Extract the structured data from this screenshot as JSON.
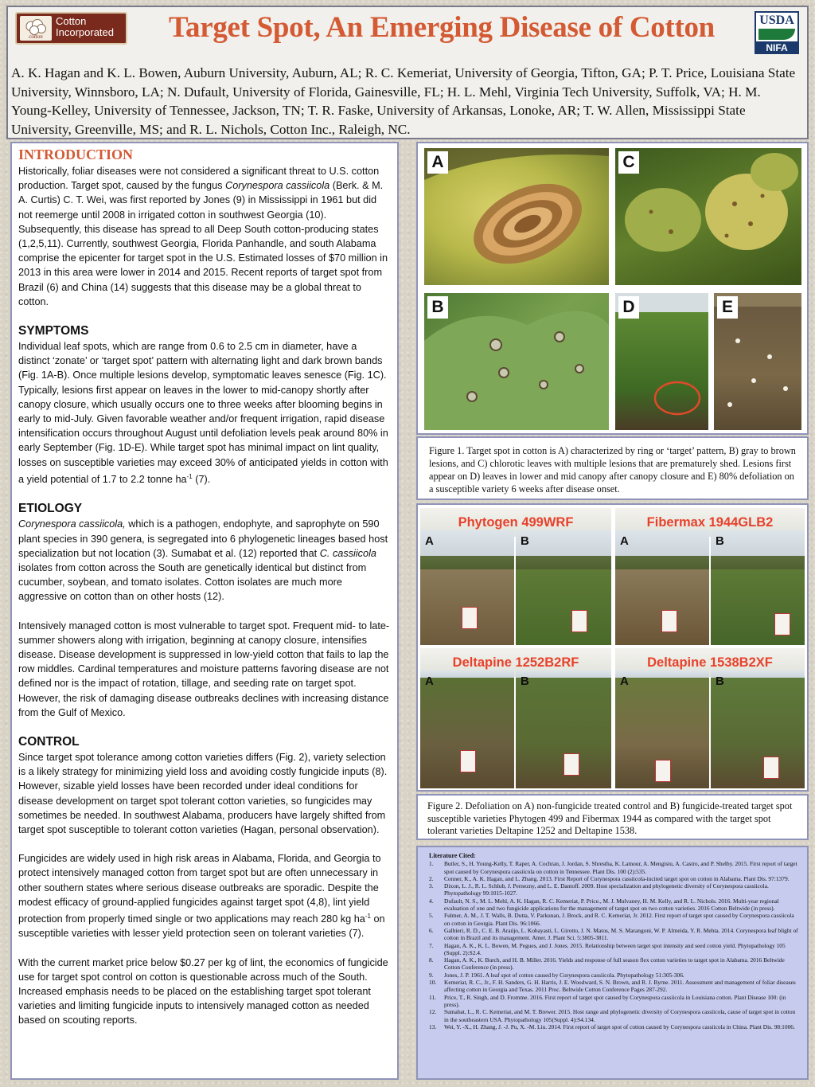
{
  "header": {
    "title": "Target Spot, An Emerging Disease of Cotton",
    "authors": "A. K. Hagan and K. L. Bowen, Auburn University, Auburn, AL; R. C. Kemeriat, University of Georgia, Tifton, GA; P. T. Price, Louisiana State University, Winnsboro, LA; N. Dufault, University of Florida, Gainesville, FL; H. L. Mehl, Virginia Tech University, Suffolk, VA; H. M. Young-Kelley, University of Tennessee, Jackson, TN; T. R. Faske, University of Arkansas, Lonoke, AR; T. W. Allen, Mississippi State University, Greenville, MS; and R. L. Nichols, Cotton Inc., Raleigh, NC.",
    "left_logo": {
      "line1": "Cotton",
      "line2": "Incorporated",
      "icon": "cotton-boll-icon"
    },
    "right_logo": {
      "top": "USDA",
      "bottom": "NIFA"
    }
  },
  "introduction": {
    "heading": "INTRODUCTION",
    "p1_a": "Historically, foliar diseases were not considered a significant threat to U.S. cotton production.  Target spot, caused by the fungus ",
    "p1_italic": "Corynespora cassiicola",
    "p1_b": " (Berk. & M. A. Curtis) C. T. Wei, was first reported by Jones (9) in Mississippi in 1961 but did not reemerge until 2008 in irrigated cotton in southwest Georgia (10). Subsequently, this disease has spread to all Deep South cotton-producing states (1,2,5,11). Currently, southwest Georgia, Florida Panhandle, and south Alabama comprise the epicenter for target spot in the U.S.  Estimated losses of $70 million in 2013 in this area were lower in 2014 and 2015. Recent reports of target spot from Brazil (6) and China (14) suggests that this disease may be a global threat to cotton."
  },
  "symptoms": {
    "heading": "SYMPTOMS",
    "p1_a": "Individual leaf spots, which are range from 0.6  to 2.5 cm in diameter, have a distinct ‘zonate’ or ‘target spot’ pattern with alternating light and dark brown bands (Fig. 1A-B).  Once multiple lesions develop, symptomatic leaves senesce (Fig. 1C).  Typically, lesions first appear on leaves in the lower to mid-canopy shortly after canopy closure, which usually occurs one to three weeks after blooming begins in early to mid-July.  Given favorable weather and/or frequent irrigation, rapid disease intensification occurs throughout August until defoliation levels peak around 80% in early September (Fig. 1D-E).  While target spot has minimal impact on lint quality, losses on susceptible varieties may exceed 30% of anticipated yields in cotton with a yield potential of 1.7 to 2.2 tonne ha",
    "p1_sup": "-1",
    "p1_b": " (7)."
  },
  "etiology": {
    "heading": "ETIOLOGY",
    "p1_italic": "Corynespora cassiicola,",
    "p1_a": " which is a pathogen, endophyte, and saprophyte on 590 plant species in 390 genera, is segregated into 6 phylogenetic lineages based host specialization but not location (3).  Sumabat et al. (12) reported that ",
    "p1_italic2": "C. cassiicola",
    "p1_b": " isolates from cotton across the South are genetically identical but distinct from cucumber, soybean, and tomato isolates.  Cotton isolates are much more aggressive on cotton than on other hosts (12).",
    "p2": "Intensively managed cotton is most vulnerable to target spot. Frequent mid- to late-summer showers along with irrigation, beginning at canopy closure, intensifies disease. Disease development is suppressed in low-yield cotton that fails to lap the row middles. Cardinal temperatures and moisture patterns favoring disease are not defined nor is the impact of rotation, tillage, and seeding rate on target spot. However, the risk of damaging disease outbreaks declines with increasing distance from the Gulf of Mexico."
  },
  "control": {
    "heading": "CONTROL",
    "p1": "Since target spot tolerance among cotton varieties differs (Fig. 2), variety selection is a likely strategy for minimizing yield loss and avoiding costly fungicide inputs (8). However, sizable yield losses have been recorded under ideal conditions for disease development on target spot tolerant cotton varieties, so fungicides may sometimes be needed.  In southwest Alabama, producers have largely shifted from target spot susceptible to tolerant cotton varieties (Hagan, personal observation).",
    "p2_a": "Fungicides are widely used in high risk areas in Alabama, Florida, and Georgia to protect intensively managed cotton from target spot but are often unnecessary in other southern states where serious disease outbreaks are sporadic. Despite the modest efficacy of ground-applied fungicides against target spot (4,8), lint yield protection from properly timed single or two applications may reach 280 kg ha",
    "p2_sup": "-1",
    "p2_b": " on susceptible varieties with lesser yield protection seen on tolerant varieties (7).",
    "p3": "With the current market price below $0.27 per kg of lint, the economics of fungicide use for target spot control on cotton is questionable across much of the South. Increased emphasis needs to be placed on the establishing target spot tolerant varieties and limiting fungicide inputs to intensively managed cotton as needed based on scouting reports."
  },
  "figure1": {
    "labels": [
      "A",
      "C",
      "B",
      "D",
      "E"
    ],
    "caption": "Figure 1. Target spot in cotton is A) characterized by ring or ‘target’ pattern, B) gray to brown lesions, and C) chlorotic leaves with multiple lesions that are prematurely shed.  Lesions first appear on D) leaves in lower and mid canopy after canopy closure and E) 80% defoliation on a susceptible variety 6 weeks after disease onset."
  },
  "figure2": {
    "panels": [
      {
        "title": "Phytogen 499WRF",
        "a": "A",
        "b": "B"
      },
      {
        "title": "Fibermax 1944GLB2",
        "a": "A",
        "b": "B"
      },
      {
        "title": "Deltapine 1252B2RF",
        "a": "A",
        "b": "B"
      },
      {
        "title": "Deltapine 1538B2XF",
        "a": "A",
        "b": "B"
      }
    ],
    "caption": "Figure 2. Defoliation on A) non-fungicide treated control and B) fungicide-treated target spot susceptible varieties Phytogen 499 and Fibermax 1944 as compared with the target spot tolerant varieties Deltapine 1252 and Deltapine 1538."
  },
  "literature": {
    "heading": "Literature Cited:",
    "refs": [
      {
        "n": "1.",
        "text": "Butler, S., H. Young-Kelly, T. Raper, A. Cochran, J. Jordan, S. Shrestha, K. Lamour, A. Mengistu, A. Castro, and P. Shelby. 2015. First report of target spot caused by Corynespora cassiicola on cotton in Tennessee.  Plant Dis. 100 (2):535."
      },
      {
        "n": "2.",
        "text": "Conner, K., A. K. Hagan, and L. Zhang. 2013. First Report of Corynespora cassiicola-incited target spot on cotton in Alabama. Plant Dis. 97:1379."
      },
      {
        "n": "3.",
        "text": "Dixon, L. J., R. L. Schlub, J. Pernezny, and L. E. Dantoff. 2009. Host specialization and phylogenetic diversity of Corynespora cassiicola.  Phytopathology 99:1015-1027."
      },
      {
        "n": "4.",
        "text": "Dufault, N. S., M. L. Mehl, A. K. Hagan, R. C. Kemeriat, P. Price., M. J. Mulvaney, H. M. Kelly, and R. L. Nichols. 2016. Multi-year regional evaluation of one and two fungicide applications for the management of target spot on two cotton varieties. 2016 Cotton Beltwide (in press)."
      },
      {
        "n": "5.",
        "text": "Fulmer, A. M., J. T. Walls, B. Dutta, V. Parkunan, J. Brock, and R. C. Kemeriat, Jr. 2012. First report of target spot caused by Corynespora cassiicola on cotton in Georgia. Plant Dis. 96:1066."
      },
      {
        "n": "6.",
        "text": "Galbieri, R. D., C. E. B. Araújo, L. Kobayasti, L. Girotto, J. N. Matos, M. S. Marangoni, W. P. Almeida, Y. R. Mehta. 2014. Corynespora leaf blight of cotton in Brazil and its management.  Amer. J. Plant Sci. 5:3805-3811."
      },
      {
        "n": "7.",
        "text": "Hagan, A. K., K. L. Bowen, M. Pegues, and J. Jones. 2015. Relationship between target spot intensity and seed cotton yield. Phytopathology 105 (Suppl. 2):S2.4."
      },
      {
        "n": "8.",
        "text": "Hagan, A. K., K. Burch, and H. B. Miller. 2016. Yields and response of full season flex cotton varieties to target spot in Alabama. 2016 Beltwide Cotton Conference (in press)."
      },
      {
        "n": "9.",
        "text": "Jones, J. P. 1961. A leaf spot of cotton caused by Corynespora cassiicola. Phytopathology 51:305-306."
      },
      {
        "n": "10.",
        "text": "Kemeriat, R. C., Jr., F. H. Sanders, G. H. Harris, J. E. Woodward, S. N. Brown, and R. J. Byrne. 2011. Assessment and management of foliar diseases affecting cotton in Georgia and Texas. 2011 Proc. Beltwide Cotton Conference Pages 287-292."
      },
      {
        "n": "11.",
        "text": "Price, T., R. Singh, and D. Fromme. 2016. First report of target spot caused by Corynespora cassiicola in Louisiana cotton. Plant Disease 100: (in press)."
      },
      {
        "n": "12.",
        "text": "Sumabat, L., R. C. Kemeriat, and M. T. Brewer. 2015. Host range and phylogenetic diversity of Corynespora cassiicola, cause of target spot in cotton in the southeastern USA.  Phytopathology 105(Suppl. 4):S4.134."
      },
      {
        "n": "13.",
        "text": "Wei, Y. -X., H. Zhang, J. -J. Pu, X. -M. Liu. 2014. First report of target spot of cotton caused by Corynespora cassiicola in China.  Plant Dis. 98:1006."
      }
    ]
  },
  "colors": {
    "title": "#d35a33",
    "panel_border": "#8f93b8",
    "literature_bg": "#c7ccef",
    "fig2_titles": "#e8412b"
  }
}
